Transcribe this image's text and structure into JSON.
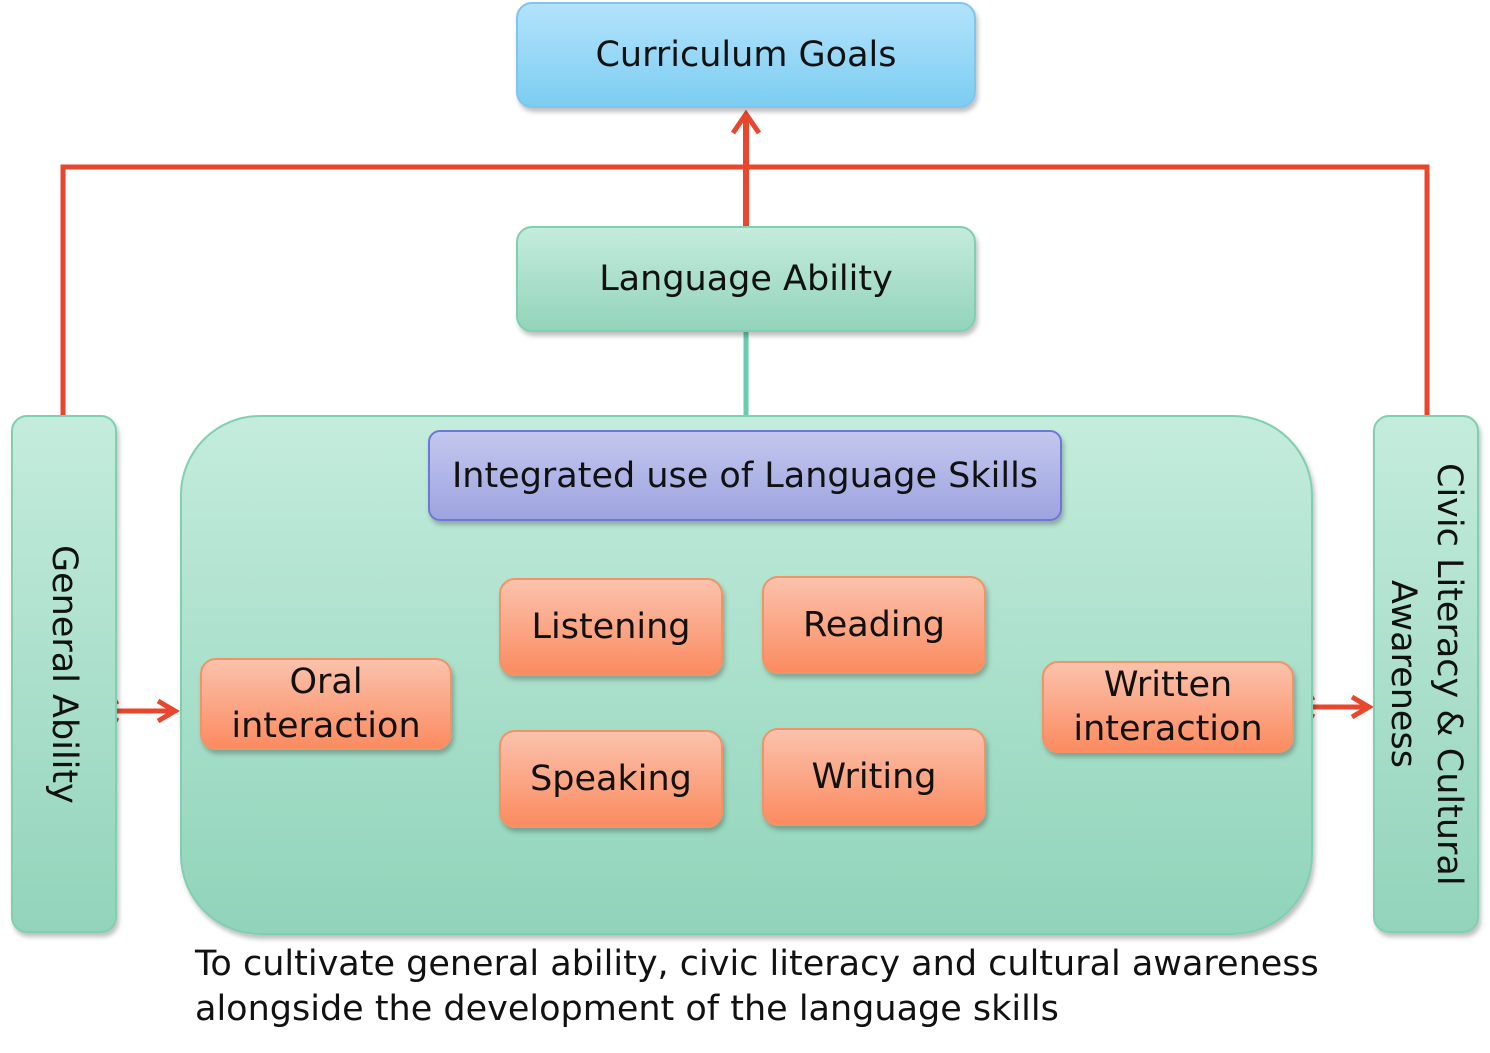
{
  "diagram": {
    "goal": "Curriculum Goals",
    "language_ability": "Language Ability",
    "general_ability": "General Ability",
    "civic": "Civic Literacy & Cultural Awareness",
    "integrated": "Integrated use of Language Skills",
    "skills": {
      "listening": "Listening",
      "reading": "Reading",
      "speaking": "Speaking",
      "writing": "Writing"
    },
    "oral": "Oral interaction",
    "written": "Written interaction",
    "caption_line1": "To cultivate general ability, civic literacy and cultural awareness",
    "caption_line2": "alongside the development of the language skills"
  },
  "colors": {
    "arrow": "#e8472e",
    "connector_green": "#67cdb0"
  }
}
